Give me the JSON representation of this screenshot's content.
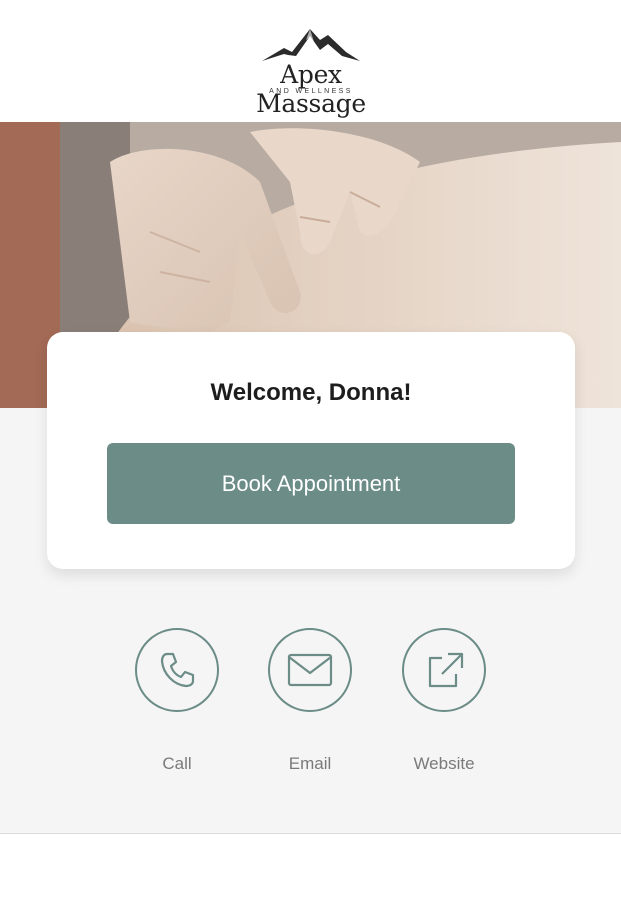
{
  "header": {
    "logo_name": "Apex Massage",
    "logo_sub": "AND WELLNESS"
  },
  "hero": {
    "image": "massage-hands-photo"
  },
  "card": {
    "welcome": "Welcome, Donna!",
    "book_label": "Book Appointment"
  },
  "actions": [
    {
      "label": "Call",
      "icon": "phone-icon"
    },
    {
      "label": "Email",
      "icon": "envelope-icon"
    },
    {
      "label": "Website",
      "icon": "external-link-icon"
    }
  ],
  "colors": {
    "accent": "#6b8c87",
    "background": "#f5f5f5",
    "card": "#ffffff",
    "label": "#7a7a7a",
    "heading": "#1d1d1d"
  }
}
